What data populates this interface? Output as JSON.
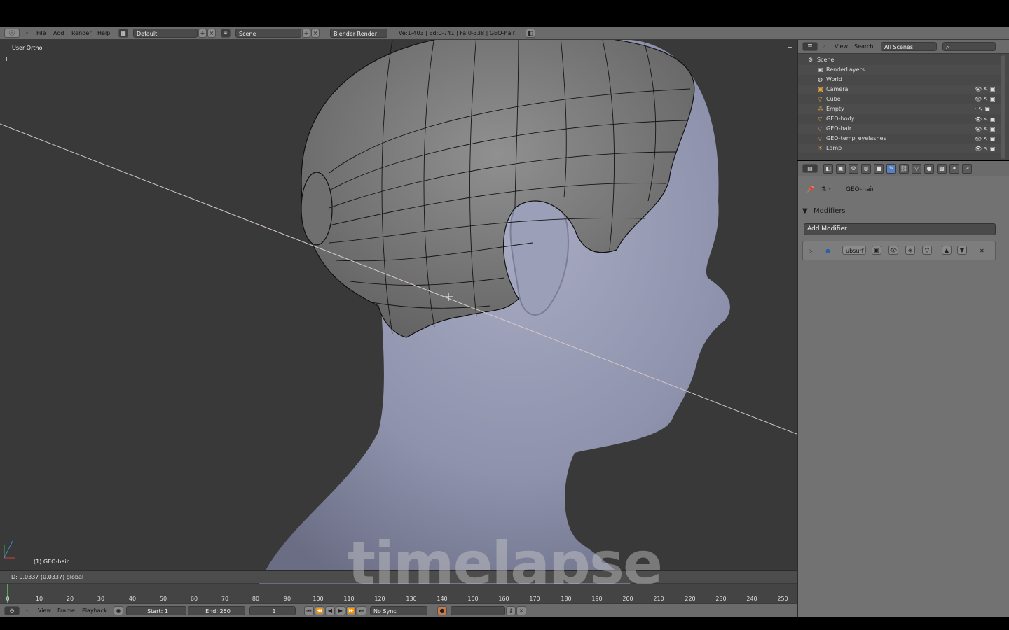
{
  "header": {
    "menus": [
      "File",
      "Add",
      "Render",
      "Help"
    ],
    "screen_layout": "Default",
    "scene": "Scene",
    "render_engine": "Blender Render",
    "stats": "Ve:1-403 | Ed:0-741 | Fa:0-338 | GEO-hair"
  },
  "viewport": {
    "view_name": "User Ortho",
    "active_object": "(1) GEO-hair",
    "status_text": "D: 0.0337 (0.0337) global"
  },
  "watermark": "timelapse",
  "timeline": {
    "ruler": [
      "0",
      "10",
      "20",
      "30",
      "40",
      "50",
      "60",
      "70",
      "80",
      "90",
      "100",
      "110",
      "120",
      "130",
      "140",
      "150",
      "160",
      "170",
      "180",
      "190",
      "200",
      "210",
      "220",
      "230",
      "240",
      "250"
    ],
    "menus": [
      "View",
      "Frame",
      "Playback"
    ],
    "start": "Start: 1",
    "end": "End: 250",
    "current": "1",
    "sync": "No Sync"
  },
  "outliner": {
    "menus": [
      "View",
      "Search"
    ],
    "filter": "All Scenes",
    "items": [
      {
        "label": "Scene"
      },
      {
        "label": "RenderLayers"
      },
      {
        "label": "World"
      },
      {
        "label": "Camera"
      },
      {
        "label": "Cube"
      },
      {
        "label": "Empty"
      },
      {
        "label": "GEO-body"
      },
      {
        "label": "GEO-hair"
      },
      {
        "label": "GEO-temp_eyelashes"
      },
      {
        "label": "Lamp"
      }
    ]
  },
  "properties": {
    "breadcrumb": "GEO-hair",
    "panel_title": "Modifiers",
    "add_modifier": "Add Modifier",
    "modifier_name": "ubsurf"
  },
  "colors": {
    "viewport_bg": "#393939",
    "header_bg": "#6b6b6b",
    "active_tab": "#5680c2",
    "skin": "#9ea2bb"
  }
}
